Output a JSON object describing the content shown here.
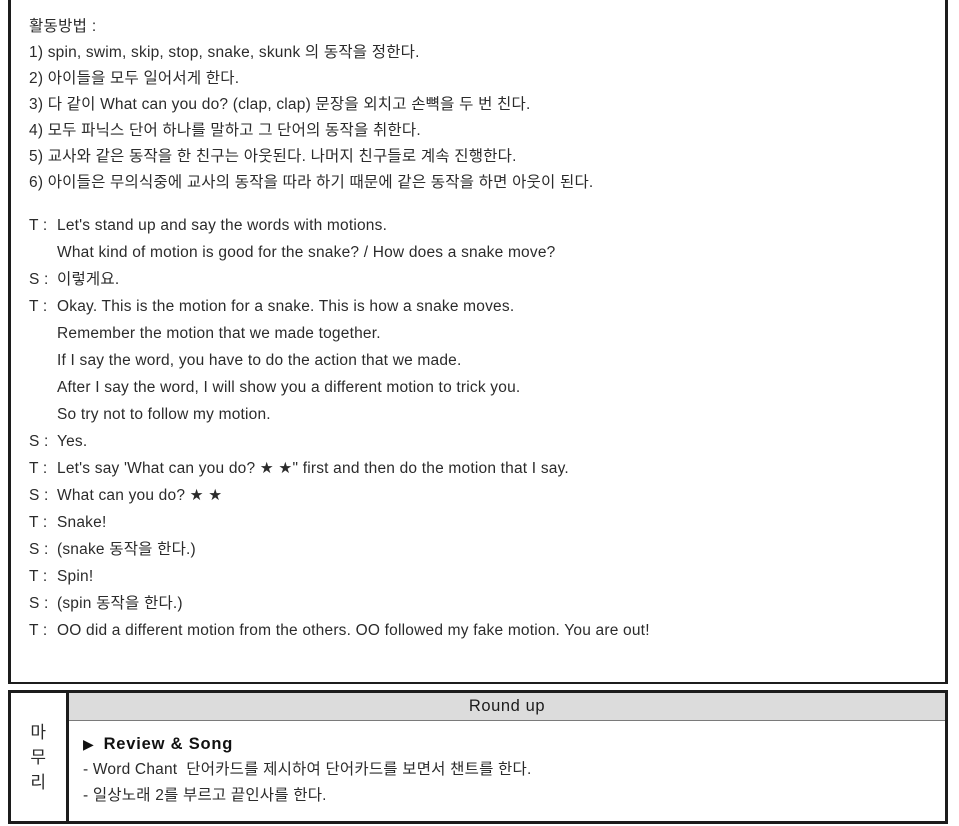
{
  "activity": {
    "title": "활동방법 :",
    "steps": [
      "1) spin, swim, skip, stop, snake, skunk 의 동작을 정한다.",
      "2) 아이들을 모두 일어서게 한다.",
      "3) 다 같이 What can you do? (clap, clap) 문장을 외치고 손뼉을 두 번 친다.",
      "4) 모두 파닉스 단어 하나를 말하고 그 단어의 동작을 취한다.",
      "5) 교사와 같은 동작을 한 친구는 아웃된다. 나머지 친구들로 계속 진행한다.",
      "6) 아이들은 무의식중에 교사의 동작을 따라 하기 때문에 같은 동작을 하면 아웃이 된다."
    ],
    "dialogue": [
      {
        "speaker": "T :",
        "text": "Let's stand up and say the words with motions.",
        "continuation": false
      },
      {
        "speaker": "T :",
        "text": "What kind of motion is good for the snake? / How does a snake move?",
        "continuation": true
      },
      {
        "speaker": "S :",
        "text": "이렇게요.",
        "continuation": false
      },
      {
        "speaker": "T :",
        "text": "Okay. This is the motion for a snake. This is how a snake moves.",
        "continuation": false
      },
      {
        "speaker": "T :",
        "text": "Remember the motion that we made together.",
        "continuation": true
      },
      {
        "speaker": "T :",
        "text": "If I say the word, you have to do the action that we made.",
        "continuation": true
      },
      {
        "speaker": "T :",
        "text": "After I say the word, I will show you a different motion to trick you.",
        "continuation": true
      },
      {
        "speaker": "T :",
        "text": "So try not to follow my motion.",
        "continuation": true
      },
      {
        "speaker": "S :",
        "text": "Yes.",
        "continuation": false
      },
      {
        "speaker": "T :",
        "text": "Let's say 'What can you do? ★ ★\" first and then do the motion that I say.",
        "continuation": false
      },
      {
        "speaker": "S :",
        "text": "What can you do? ★ ★",
        "continuation": false
      },
      {
        "speaker": "T :",
        "text": "Snake!",
        "continuation": false
      },
      {
        "speaker": "S :",
        "text": "(snake 동작을 한다.)",
        "continuation": false
      },
      {
        "speaker": "T :",
        "text": "Spin!",
        "continuation": false
      },
      {
        "speaker": "S :",
        "text": "(spin 동작을 한다.)",
        "continuation": false
      },
      {
        "speaker": "T :",
        "text": "OO did a different motion from the others. OO followed my fake motion. You are out!",
        "continuation": false
      }
    ]
  },
  "roundup": {
    "stage_label_chars": [
      "마",
      "무",
      "리"
    ],
    "header_title": "Round up",
    "heading_marker": "▶",
    "heading": "Review & Song",
    "lines": [
      "- Word Chant  단어카드를 제시하여 단어카드를 보면서 챈트를 한다.",
      "- 일상노래 2를 부르고 끝인사를 한다."
    ]
  },
  "colors": {
    "border": "#1c1c1c",
    "header_bg": "#dcdcdc",
    "text": "#2b2b2b"
  }
}
